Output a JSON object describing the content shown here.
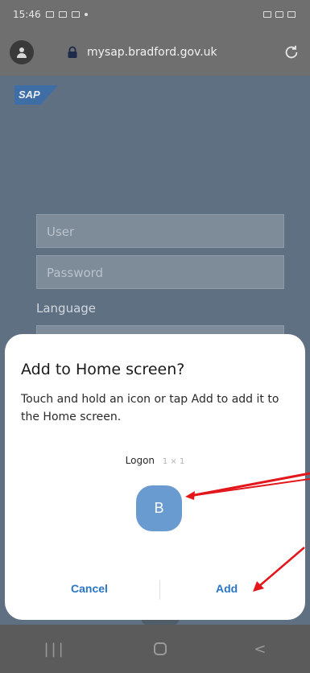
{
  "status_bar": {
    "time": "15:46"
  },
  "browser": {
    "url": "mysap.bradford.gov.uk"
  },
  "login": {
    "logo_text": "SAP",
    "user_placeholder": "User",
    "password_placeholder": "Password",
    "language_label": "Language"
  },
  "dialog": {
    "title": "Add to Home screen?",
    "description": "Touch and hold an icon or tap Add to add it to the Home screen.",
    "shortcut_name": "Logon",
    "shortcut_size": "1 × 1",
    "icon_letter": "B",
    "cancel_label": "Cancel",
    "add_label": "Add"
  },
  "colors": {
    "accent": "#2a75c6",
    "icon_bg": "#6a9bd0",
    "annotation": "#e3161b"
  },
  "nav": {
    "recent_glyph": "|||",
    "back_glyph": "<"
  }
}
